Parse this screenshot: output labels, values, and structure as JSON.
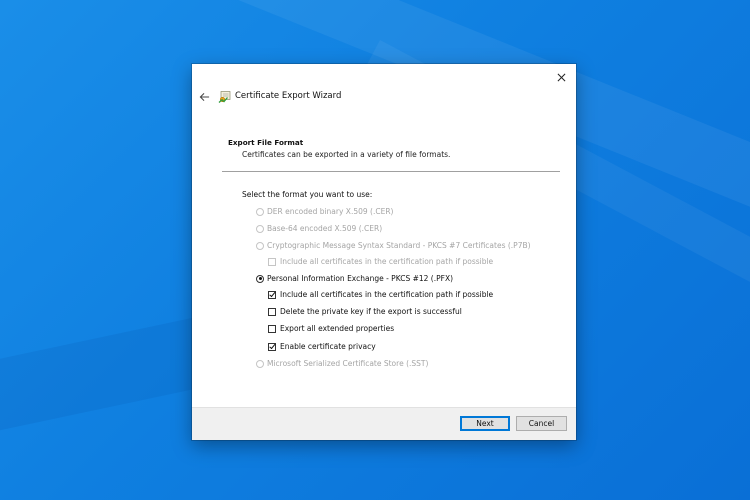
{
  "wizard": {
    "title": "Certificate Export Wizard"
  },
  "section": {
    "title": "Export File Format",
    "description": "Certificates can be exported in a variety of file formats."
  },
  "prompt": "Select the format you want to use:",
  "options": {
    "der": {
      "label": "DER encoded binary X.509 (.CER)",
      "selected": false,
      "enabled": false
    },
    "base64": {
      "label": "Base-64 encoded X.509 (.CER)",
      "selected": false,
      "enabled": false
    },
    "pkcs7": {
      "label": "Cryptographic Message Syntax Standard - PKCS #7 Certificates (.P7B)",
      "selected": false,
      "enabled": false
    },
    "pkcs7_include_all": {
      "label": "Include all certificates in the certification path if possible",
      "checked": false,
      "enabled": false
    },
    "pfx": {
      "label": "Personal Information Exchange - PKCS #12 (.PFX)",
      "selected": true,
      "enabled": true
    },
    "pfx_include_all": {
      "label": "Include all certificates in the certification path if possible",
      "checked": true,
      "enabled": true
    },
    "pfx_delete_key": {
      "label": "Delete the private key if the export is successful",
      "checked": false,
      "enabled": true
    },
    "pfx_export_ext": {
      "label": "Export all extended properties",
      "checked": false,
      "enabled": true
    },
    "pfx_privacy": {
      "label": "Enable certificate privacy",
      "checked": true,
      "enabled": true
    },
    "sst": {
      "label": "Microsoft Serialized Certificate Store (.SST)",
      "selected": false,
      "enabled": false
    }
  },
  "buttons": {
    "next": "Next",
    "cancel": "Cancel"
  },
  "icons": {
    "close": "close-icon",
    "back": "back-arrow-icon",
    "wizard": "certificate-icon"
  },
  "colors": {
    "desktop": "#0f7fe0",
    "accent": "#0078d7"
  }
}
